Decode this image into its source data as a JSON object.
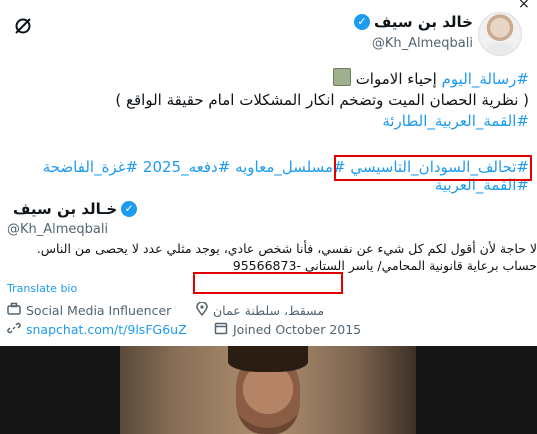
{
  "tweet": {
    "author_name": "خالد بن سيف",
    "author_handle": "@Kh_Almeqbali",
    "lines": [
      [
        "#رسالة_اليوم",
        " إحياء الاموات "
      ],
      "( نظرية الحصان الميت وتضخم انكار المشكلات امام حقيقة الواقع )",
      "#القمة_العربية_الطارئة",
      "",
      [
        "#تحالف_السودان_التاسيسي",
        " #مسلسل_معاويه",
        " #دفعه_2025",
        " #غزة_الفاضحة"
      ],
      "#القمة_العربية"
    ]
  },
  "profile_card": {
    "name": "خـالد بن سيف",
    "handle": "@Kh_Almeqbali",
    "bio_line1": "لا حاجة لأن أقول لكم كل شيء عن نفسي، فأنا شخص عادي، يوجد مثلي عدد لا يحصى من الناس.",
    "bio_line2": "حساب برعاية قانونية المحامي/ ياسر الستاني -95566873",
    "translate_label": "Translate bio",
    "category": "Social Media Influencer",
    "location": "مسقط، سلطنة عمان",
    "link": "snapchat.com/t/9lsFG6uZ",
    "joined": "Joined October 2015"
  },
  "colors": {
    "accent": "#1d9bf0",
    "highlight_box": "#e00000",
    "secondary_text": "#536471"
  },
  "icons": {
    "close": "×",
    "grok": "slash-circle-icon",
    "verified": "verified-badge-icon"
  }
}
